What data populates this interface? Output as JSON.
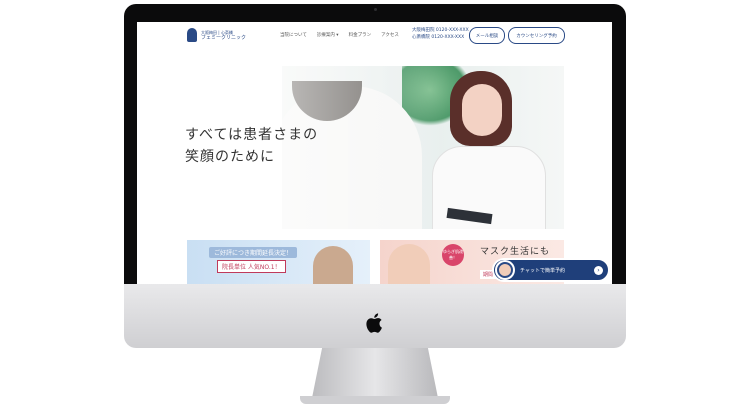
{
  "site": {
    "logo_sub": "大阪梅田 | 心斎橋",
    "logo_main": "フェミークリニック",
    "nav": [
      "当院について",
      "診療案内 ▾",
      "料金プラン",
      "アクセス"
    ],
    "phones": [
      "大阪梅田院 0120-XXX-XXX",
      "心斎橋院 0120-XXX-XXX"
    ],
    "mail_button": "メール相談",
    "counsel_button": "カウンセリング予約"
  },
  "hero": {
    "line1": "すべては患者さまの",
    "line2": "笑顔のために"
  },
  "banners": {
    "a_title": "ご好評につき期間延長決定！",
    "a_sub": "院長単位 人気NO.1！",
    "b_badge": "ゆらぎ肌改善！",
    "b_title": "マスク生活にも",
    "b_small": "期間"
  },
  "chat": {
    "label": "チャットで簡単予約"
  },
  "colors": {
    "brand": "#2a4a86",
    "accent": "#c03a5b",
    "chat_bg": "#1f3f7a"
  }
}
